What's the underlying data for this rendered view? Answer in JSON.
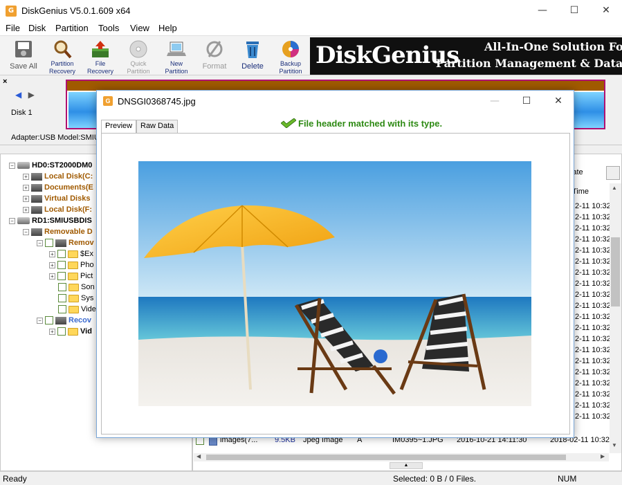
{
  "window": {
    "title": "DiskGenius V5.0.1.609 x64",
    "app_icon_letter": "G",
    "minimize": "—",
    "maximize": "☐",
    "close": "✕"
  },
  "menu": [
    "File",
    "Disk",
    "Partition",
    "Tools",
    "View",
    "Help"
  ],
  "toolbar": {
    "save_all": "Save All",
    "file_recovery_1": "Partition",
    "file_recovery_1b": "Recovery",
    "file_recovery_2": "File",
    "file_recovery_2b": "Recovery",
    "quick_partition": "Quick",
    "quick_partition_b": "Partition",
    "new_partition": "New",
    "new_partition_b": "Partition",
    "format": "Format",
    "delete": "Delete",
    "backup_partition": "Backup",
    "backup_partition_b": "Partition"
  },
  "banner": {
    "brand": "DiskGenius",
    "tagline_1": "All-In-One Solution For",
    "tagline_2": "Partition Management & Data Reco"
  },
  "disk_panel": {
    "close": "×",
    "disk_label": "Disk  1",
    "adapter_text": "Adapter:USB  Model:SMIU"
  },
  "tree": [
    {
      "text": "HD0:ST2000DM0",
      "level": 0,
      "type": "disk",
      "style": "bold",
      "expand": "−"
    },
    {
      "text": "Local Disk(C:",
      "level": 1,
      "type": "part",
      "style": "brown",
      "expand": "+"
    },
    {
      "text": "Documents(E",
      "level": 1,
      "type": "part",
      "style": "brown",
      "expand": "+"
    },
    {
      "text": "Virtual Disks",
      "level": 1,
      "type": "part",
      "style": "brown",
      "expand": "+"
    },
    {
      "text": "Local Disk(F:",
      "level": 1,
      "type": "part",
      "style": "brown",
      "expand": "+"
    },
    {
      "text": "RD1:SMIUSBDIS",
      "level": 0,
      "type": "disk",
      "style": "bold",
      "expand": "−"
    },
    {
      "text": "Removable D",
      "level": 1,
      "type": "part",
      "style": "brown",
      "expand": "−"
    },
    {
      "text": "Remov",
      "level": 2,
      "type": "hddchk",
      "style": "brown",
      "expand": "−"
    },
    {
      "text": "$Ex",
      "level": 3,
      "type": "folder",
      "style": "",
      "expand": "+"
    },
    {
      "text": "Pho",
      "level": 3,
      "type": "folder",
      "style": "",
      "expand": "+"
    },
    {
      "text": "Pict",
      "level": 3,
      "type": "folder",
      "style": "",
      "expand": "+"
    },
    {
      "text": "Son",
      "level": 3,
      "type": "folder",
      "style": "",
      "expand": ""
    },
    {
      "text": "Sys",
      "level": 3,
      "type": "folder",
      "style": "",
      "expand": ""
    },
    {
      "text": "Vide",
      "level": 3,
      "type": "folder",
      "style": "",
      "expand": ""
    },
    {
      "text": "Recov",
      "level": 2,
      "type": "hddchk",
      "style": "blue",
      "expand": "−"
    },
    {
      "text": "Vid",
      "level": 3,
      "type": "folder",
      "style": "bold",
      "expand": "+"
    }
  ],
  "file_list": {
    "duplicate_label": "licate",
    "time_header": "Time",
    "time_cells": [
      "2-11 10:32",
      "2-11 10:32",
      "2-11 10:32",
      "2-11 10:32",
      "2-11 10:32",
      "2-11 10:32",
      "2-11 10:32",
      "2-11 10:32",
      "2-11 10:32",
      "2-11 10:32",
      "2-11 10:32",
      "2-11 10:32",
      "2-11 10:32",
      "2-11 10:32",
      "2-11 10:32",
      "2-11 10:32",
      "2-11 10:32",
      "2-11 10:32",
      "2-11 10:32",
      "2-11 10:32"
    ],
    "visible_row": {
      "name": "images(7...",
      "size": "9.5KB",
      "type": "Jpeg Image",
      "attr": "A",
      "short_name": "IM0395~1.JPG",
      "modify_time": "2016-10-21 14:11:30",
      "create_time": "2018-02-11 10:32"
    }
  },
  "status": {
    "ready": "Ready",
    "selected": "Selected: 0 B / 0 Files.",
    "num": "NUM"
  },
  "dialog": {
    "title": "DNSGI0368745.jpg",
    "icon_letter": "G",
    "tab_preview": "Preview",
    "tab_raw": "Raw Data",
    "match_message": "File header matched with its type.",
    "minimize": "—",
    "maximize": "☐",
    "close": "✕"
  },
  "colors": {
    "accent_brown": "#a05a00",
    "accent_blue": "#3a6ad0",
    "match_green": "#2e8a14",
    "disk_border": "#b01070"
  }
}
